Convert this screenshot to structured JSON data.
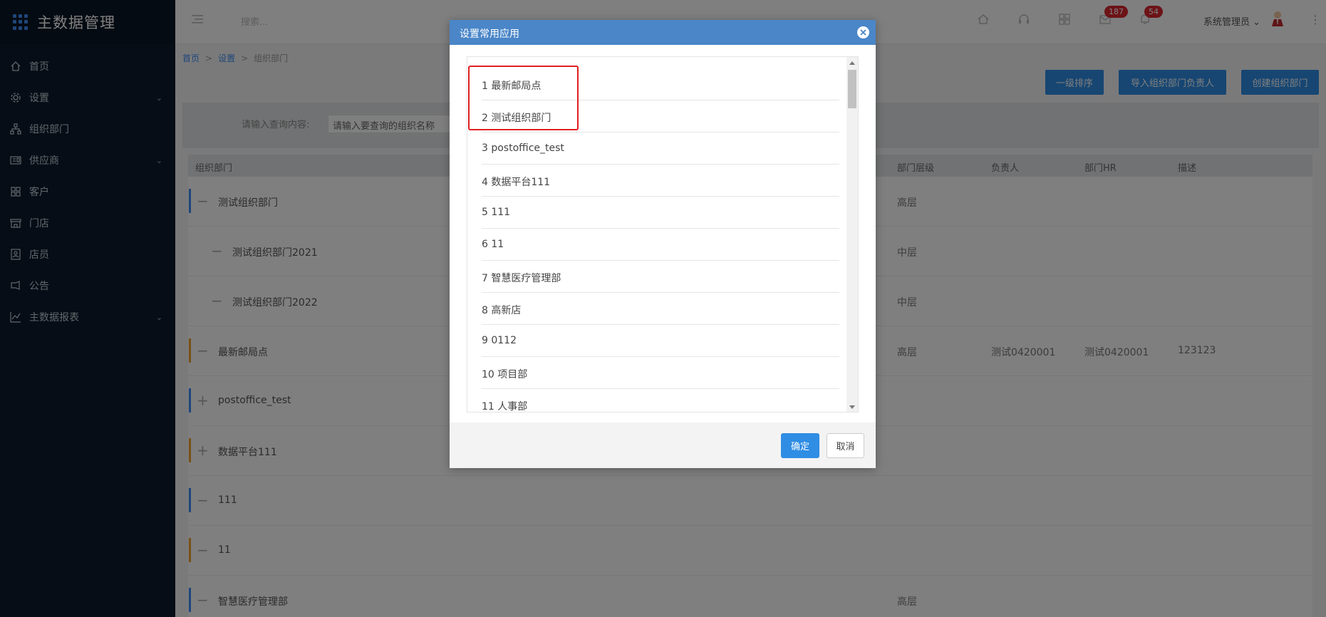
{
  "app": {
    "title": "主数据管理"
  },
  "sidebar": {
    "items": [
      {
        "label": "首页",
        "icon": "home-icon",
        "has_children": false
      },
      {
        "label": "设置",
        "icon": "gear-icon",
        "has_children": true
      },
      {
        "label": "组织部门",
        "icon": "org-chart-icon",
        "has_children": false
      },
      {
        "label": "供应商",
        "icon": "supplier-icon",
        "has_children": true
      },
      {
        "label": "客户",
        "icon": "customer-icon",
        "has_children": false
      },
      {
        "label": "门店",
        "icon": "store-icon",
        "has_children": false
      },
      {
        "label": "店员",
        "icon": "staff-icon",
        "has_children": false
      },
      {
        "label": "公告",
        "icon": "announcement-icon",
        "has_children": false
      },
      {
        "label": "主数据报表",
        "icon": "report-icon",
        "has_children": true
      }
    ]
  },
  "topbar": {
    "search_placeholder": "搜索...",
    "mail_badge": "187",
    "bell_badge": "54",
    "user_name": "系统管理员"
  },
  "breadcrumb": {
    "home": "首页",
    "settings": "设置",
    "current": "组织部门",
    "sep": ">"
  },
  "actions": {
    "sort_label": "一级排序",
    "import_label": "导入组织部门负责人",
    "create_label": "创建组织部门"
  },
  "filter": {
    "label": "请输入查询内容:",
    "placeholder": "请输入要查询的组织名称"
  },
  "table": {
    "headers": {
      "name": "组织部门",
      "level": "部门层级",
      "owner": "负责人",
      "hr": "部门HR",
      "desc": "描述"
    },
    "rows": [
      {
        "toggle": "−",
        "name": "测试组织部门",
        "level": "高层",
        "owner": "",
        "hr": "",
        "desc": "",
        "color": "#3d8df5",
        "indent": 0
      },
      {
        "toggle": "−",
        "name": "测试组织部门2021",
        "level": "中层",
        "owner": "",
        "hr": "",
        "desc": "",
        "color": "",
        "indent": 1
      },
      {
        "toggle": "−",
        "name": "测试组织部门2022",
        "level": "中层",
        "owner": "",
        "hr": "",
        "desc": "",
        "color": "",
        "indent": 1
      },
      {
        "toggle": "−",
        "name": "最新邮局点",
        "level": "高层",
        "owner": "测试0420001",
        "hr": "测试0420001",
        "desc": "123123",
        "color": "#f0a030",
        "indent": 0
      },
      {
        "toggle": "+",
        "name": "postoffice_test",
        "level": "",
        "owner": "",
        "hr": "",
        "desc": "",
        "color": "#3d8df5",
        "indent": 0
      },
      {
        "toggle": "+",
        "name": "数据平台111",
        "level": "",
        "owner": "",
        "hr": "",
        "desc": "",
        "color": "#f0a030",
        "indent": 0
      },
      {
        "toggle": "−",
        "name": "111",
        "level": "",
        "owner": "",
        "hr": "",
        "desc": "",
        "color": "#3d8df5",
        "indent": 0
      },
      {
        "toggle": "−",
        "name": "11",
        "level": "",
        "owner": "",
        "hr": "",
        "desc": "",
        "color": "#f0a030",
        "indent": 0
      },
      {
        "toggle": "−",
        "name": "智慧医疗管理部",
        "level": "高层",
        "owner": "",
        "hr": "",
        "desc": "",
        "color": "#3d8df5",
        "indent": 0
      }
    ]
  },
  "modal": {
    "title": "设置常用应用",
    "items": [
      "1 最新邮局点",
      "2 测试组织部门",
      "3 postoffice_test",
      "4 数据平台111",
      "5 111",
      "6 11",
      "7 智慧医疗管理部",
      "8 高新店",
      "9 0112",
      "10 项目部",
      "11 人事部"
    ],
    "ok_label": "确定",
    "cancel_label": "取消"
  }
}
